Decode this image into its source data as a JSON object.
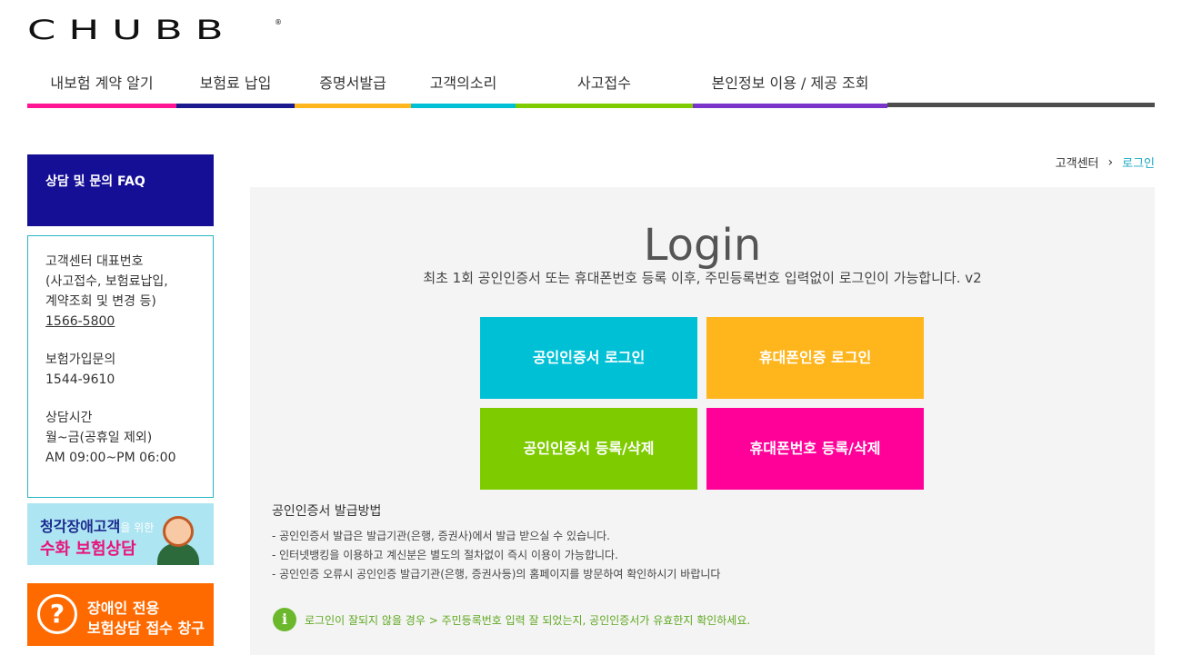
{
  "logo": {
    "text": "CHUBB",
    "reg": "®"
  },
  "nav": {
    "items": [
      {
        "label": "내보험 계약 알기",
        "color": "#ff1493"
      },
      {
        "label": "보험료 납입",
        "color": "#1a1a8e"
      },
      {
        "label": "증명서발급",
        "color": "#ffb51c"
      },
      {
        "label": "고객의소리",
        "color": "#00c0d6"
      },
      {
        "label": "사고접수",
        "color": "#7ecb00"
      },
      {
        "label": "본인정보 이용 / 제공 조회",
        "color": "#7b34c9"
      }
    ],
    "rest_color": "#4d4d4d"
  },
  "sidebar": {
    "faq": "상담 및 문의 FAQ",
    "contact": {
      "rep_title": "고객센터 대표번호",
      "rep_desc1": "(사고접수, 보험료납입,",
      "rep_desc2": "계약조회 및 변경 등)",
      "rep_number": "1566-5800",
      "join_title": "보험가입문의",
      "join_number": "1544-9610",
      "hours_title": "상담시간",
      "hours_days": "월~금(공휴일 제외)",
      "hours_time": "AM 09:00~PM 06:00"
    },
    "banner_sign": {
      "line1": "청각장애고객",
      "line1_suffix": "을 위한",
      "line2": "수화 보험상담"
    },
    "banner_help": {
      "icon": "?",
      "line1": "장애인 전용",
      "line2": "보험상담 접수 창구"
    }
  },
  "breadcrumb": {
    "home": "고객센터",
    "sep": "›",
    "current": "로그인"
  },
  "main": {
    "title": "Login",
    "subtitle": "최초 1회 공인인증서 또는 휴대폰번호 등록 이후, 주민등록번호 입력없이 로그인이 가능합니다. v2",
    "buttons": {
      "cert_login": "공인인증서 로그인",
      "phone_login": "휴대폰인증 로그인",
      "cert_register": "공인인증서 등록/삭제",
      "phone_register": "휴대폰번호 등록/삭제"
    },
    "guide": {
      "title": "공인인증서 발급방법",
      "items": [
        "- 공인인증서 발급은 발급기관(은행, 증권사)에서 발급 받으실 수 있습니다.",
        "- 인터넷뱅킹을 이용하고 계신분은 별도의 절차없이 즉시 이용이 가능합니다.",
        "- 공인인증 오류시 공인인증 발급기관(은행, 증권사등)의 홈페이지를 방문하여 확인하시기 바랍니다"
      ]
    },
    "notice": "로그인이 잘되지 않을 경우 > 주민등록번호 입력 잘 되었는지, 공인인증서가 유효한지 확인하세요."
  }
}
